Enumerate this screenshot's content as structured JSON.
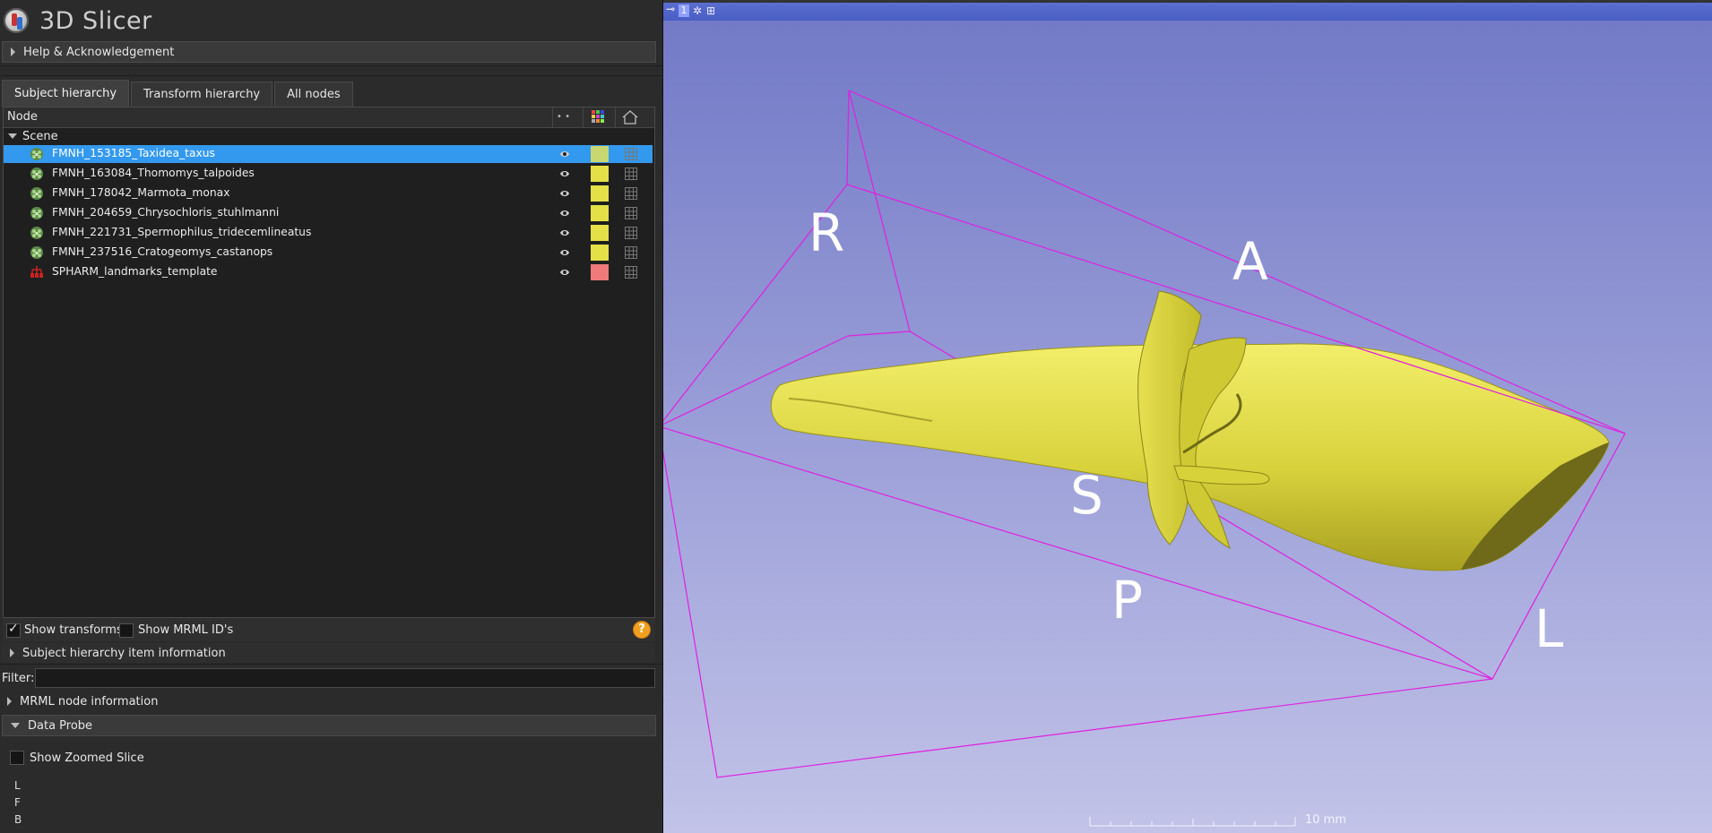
{
  "app": {
    "title": "3D Slicer"
  },
  "sections": {
    "help": "Help & Acknowledgement",
    "subject_item_info": "Subject hierarchy item information",
    "mrml_info": "MRML node information",
    "data_probe": "Data Probe"
  },
  "tabs": [
    {
      "label": "Subject hierarchy",
      "active": true
    },
    {
      "label": "Transform hierarchy",
      "active": false
    },
    {
      "label": "All nodes",
      "active": false
    }
  ],
  "tree": {
    "header": {
      "node": "Node",
      "visibility": "• •"
    },
    "scene_label": "Scene",
    "items": [
      {
        "label": "FMNH_153185_Taxidea_taxus",
        "color": "#c9d770",
        "selected": true,
        "icon": "model-icon"
      },
      {
        "label": "FMNH_163084_Thomomys_talpoides",
        "color": "#e3e048",
        "selected": false,
        "icon": "model-icon"
      },
      {
        "label": "FMNH_178042_Marmota_monax",
        "color": "#e3e048",
        "selected": false,
        "icon": "model-icon"
      },
      {
        "label": "FMNH_204659_Chrysochloris_stuhlmanni",
        "color": "#e3e048",
        "selected": false,
        "icon": "model-icon"
      },
      {
        "label": "FMNH_221731_Spermophilus_tridecemlineatus",
        "color": "#e3e048",
        "selected": false,
        "icon": "model-icon"
      },
      {
        "label": "FMNH_237516_Cratogeomys_castanops",
        "color": "#e3e048",
        "selected": false,
        "icon": "model-icon"
      },
      {
        "label": "SPHARM_landmarks_template",
        "color": "#f07a7a",
        "selected": false,
        "icon": "markups-icon"
      }
    ]
  },
  "options": {
    "show_transforms": "Show transforms",
    "show_transforms_checked": true,
    "show_mrml_ids": "Show MRML ID's",
    "show_mrml_ids_checked": false
  },
  "filter": {
    "label": "Filter:",
    "value": ""
  },
  "data_probe": {
    "show_zoomed_slice": "Show Zoomed Slice",
    "lines": [
      "L",
      "F",
      "B"
    ]
  },
  "viewer": {
    "view_number": "1",
    "orientation_labels": {
      "R": "R",
      "A": "A",
      "S": "S",
      "P": "P",
      "L": "L"
    },
    "scale_label": "10 mm",
    "background_top": "#7178c6",
    "background_bottom": "#c2c3e8",
    "box_color": "#e020e0",
    "model_color": "#e3e040"
  }
}
